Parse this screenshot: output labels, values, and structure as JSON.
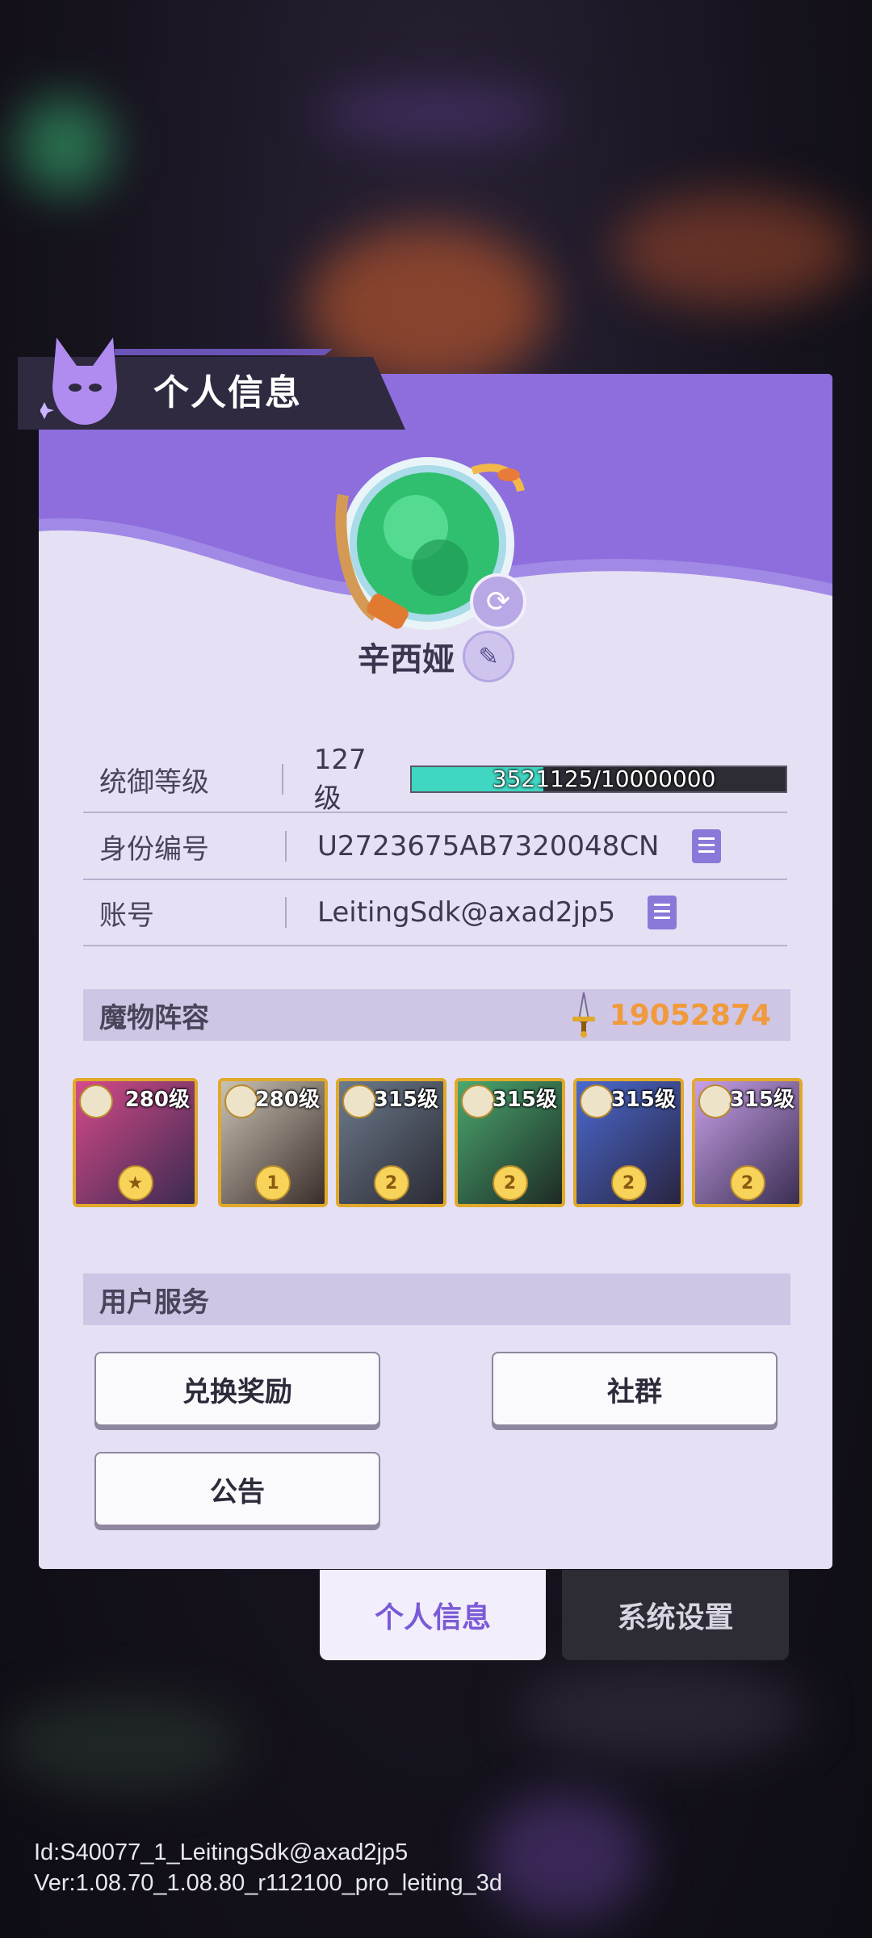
{
  "title": "个人信息",
  "profile": {
    "name": "辛西娅"
  },
  "info": {
    "level_label": "统御等级",
    "level_value": "127级",
    "xp_text": "3521125/10000000",
    "xp_progress": 0.352,
    "id_label": "身份编号",
    "id_value": "U2723675AB7320048CN",
    "account_label": "账号",
    "account_value": "LeitingSdk@axad2jp5"
  },
  "team": {
    "title": "魔物阵容",
    "power": "19052874",
    "members": [
      {
        "level": "280级",
        "star": ""
      },
      {
        "level": "280级",
        "star": "1"
      },
      {
        "level": "315级",
        "star": "2"
      },
      {
        "level": "315级",
        "star": "2"
      },
      {
        "level": "315级",
        "star": "2"
      },
      {
        "level": "315级",
        "star": "2"
      }
    ]
  },
  "services": {
    "title": "用户服务",
    "redeem": "兑换奖励",
    "community": "社群",
    "notice": "公告"
  },
  "tabs": {
    "profile": "个人信息",
    "settings": "系统设置"
  },
  "footer": {
    "id_line": "Id:S40077_1_LeitingSdk@axad2jp5",
    "ver_line": "Ver:1.08.70_1.08.80_r112100_pro_leiting_3d"
  },
  "colors": {
    "accent": "#8c6cdb",
    "power": "#f09a3c",
    "xp": "#3fd6c2"
  }
}
